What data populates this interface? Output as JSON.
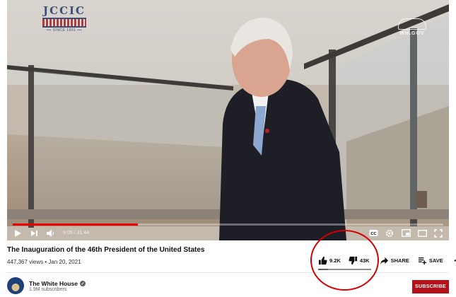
{
  "video": {
    "overlay_logo": {
      "big": "JCCIC",
      "small": "••• SINCE 1901 •••"
    },
    "watermark": "WH.GOV",
    "progress_fraction": 0.29,
    "time": "9:05 / 31:44",
    "colors": {
      "progress": "#ee0000"
    }
  },
  "info": {
    "title": "The Inauguration of the 46th President of the United States",
    "meta": "447,367 views • Jan 20, 2021",
    "likes": "9.2K",
    "dislikes": "43K",
    "share_label": "SHARE",
    "save_label": "SAVE",
    "like_ratio": 0.18
  },
  "channel": {
    "name": "The White House",
    "subscribers": "1.9M subscribers",
    "subscribe_label": "SUBSCRIBE",
    "colors": {
      "subscribe": "#b3101a"
    }
  },
  "icons": [
    "play-icon",
    "next-icon",
    "volume-icon",
    "captions-icon",
    "settings-icon",
    "miniplayer-icon",
    "theater-icon",
    "fullscreen-icon",
    "thumbs-up-icon",
    "thumbs-down-icon",
    "share-icon",
    "save-playlist-icon",
    "more-icon",
    "verified-icon"
  ]
}
